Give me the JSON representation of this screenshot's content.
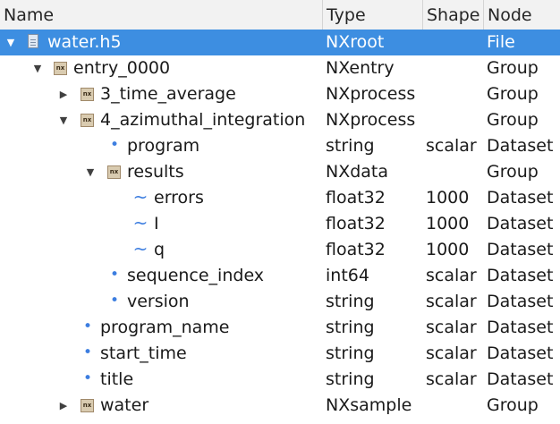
{
  "columns": {
    "name": "Name",
    "type": "Type",
    "shape": "Shape",
    "node": "Node"
  },
  "rows": [
    {
      "name": "water.h5",
      "type": "NXroot",
      "shape": "",
      "node": "File",
      "icon": "file-icon",
      "expander": "expanded"
    },
    {
      "name": "entry_0000",
      "type": "NXentry",
      "shape": "",
      "node": "Group",
      "icon": "nx-group-icon",
      "expander": "expanded"
    },
    {
      "name": "3_time_average",
      "type": "NXprocess",
      "shape": "",
      "node": "Group",
      "icon": "nx-group-icon",
      "expander": "collapsed"
    },
    {
      "name": "4_azimuthal_integration",
      "type": "NXprocess",
      "shape": "",
      "node": "Group",
      "icon": "nx-group-icon",
      "expander": "expanded"
    },
    {
      "name": "program",
      "type": "string",
      "shape": "scalar",
      "node": "Dataset",
      "icon": "scalar-dot-icon",
      "expander": "none"
    },
    {
      "name": "results",
      "type": "NXdata",
      "shape": "",
      "node": "Group",
      "icon": "nx-group-icon",
      "expander": "expanded"
    },
    {
      "name": "errors",
      "type": "float32",
      "shape": "1000",
      "node": "Dataset",
      "icon": "array-wave-icon",
      "expander": "none"
    },
    {
      "name": "I",
      "type": "float32",
      "shape": "1000",
      "node": "Dataset",
      "icon": "array-wave-icon",
      "expander": "none"
    },
    {
      "name": "q",
      "type": "float32",
      "shape": "1000",
      "node": "Dataset",
      "icon": "array-wave-icon",
      "expander": "none"
    },
    {
      "name": "sequence_index",
      "type": "int64",
      "shape": "scalar",
      "node": "Dataset",
      "icon": "scalar-dot-icon",
      "expander": "none"
    },
    {
      "name": "version",
      "type": "string",
      "shape": "scalar",
      "node": "Dataset",
      "icon": "scalar-dot-icon",
      "expander": "none"
    },
    {
      "name": "program_name",
      "type": "string",
      "shape": "scalar",
      "node": "Dataset",
      "icon": "scalar-dot-icon",
      "expander": "none"
    },
    {
      "name": "start_time",
      "type": "string",
      "shape": "scalar",
      "node": "Dataset",
      "icon": "scalar-dot-icon",
      "expander": "none"
    },
    {
      "name": "title",
      "type": "string",
      "shape": "scalar",
      "node": "Dataset",
      "icon": "scalar-dot-icon",
      "expander": "none"
    },
    {
      "name": "water",
      "type": "NXsample",
      "shape": "",
      "node": "Group",
      "icon": "nx-group-icon",
      "expander": "collapsed"
    }
  ],
  "selected_row": 0,
  "colors": {
    "selection": "#3d8ee1",
    "dataset_icon": "#3d7ee0"
  }
}
